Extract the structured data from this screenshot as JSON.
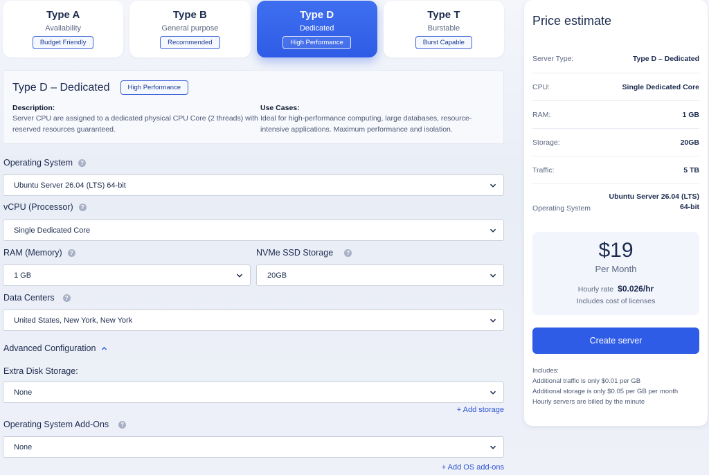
{
  "plans": [
    {
      "title": "Type A",
      "subtitle": "Availability",
      "badge": "Budget Friendly",
      "active": false
    },
    {
      "title": "Type B",
      "subtitle": "General purpose",
      "badge": "Recommended",
      "active": false
    },
    {
      "title": "Type D",
      "subtitle": "Dedicated",
      "badge": "High Performance",
      "active": true
    },
    {
      "title": "Type T",
      "subtitle": "Burstable",
      "badge": "Burst Capable",
      "active": false
    }
  ],
  "detail": {
    "title": "Type D – Dedicated",
    "badge": "High Performance",
    "description_label": "Description:",
    "description": "Server CPU are assigned to a dedicated physical CPU Core (2 threads) with reserved resources guaranteed.",
    "use_cases_label": "Use Cases:",
    "use_cases": "Ideal for high-performance computing, large databases, resource-intensive applications. Maximum performance and isolation."
  },
  "form": {
    "os_label": "Operating System",
    "os_value": "Ubuntu Server 26.04 (LTS) 64-bit",
    "vcpu_label": "vCPU (Processor)",
    "vcpu_value": "Single Dedicated Core",
    "ram_label": "RAM (Memory)",
    "ram_value": "1 GB",
    "storage_label": "NVMe SSD Storage",
    "storage_value": "20GB",
    "dc_label": "Data Centers",
    "dc_value": "United States, New York, New York",
    "advanced_label": "Advanced Configuration",
    "extra_disk_label": "Extra Disk Storage:",
    "extra_disk_value": "None",
    "add_storage": "+ Add storage",
    "os_addons_label": "Operating System Add-Ons",
    "os_addons_value": "None",
    "add_os_addons": "+ Add OS add-ons",
    "help_glyph": "?"
  },
  "estimate": {
    "title": "Price estimate",
    "rows": [
      {
        "key": "Server Type:",
        "value": "Type D – Dedicated"
      },
      {
        "key": "CPU:",
        "value": "Single Dedicated Core"
      },
      {
        "key": "RAM:",
        "value": "1 GB"
      },
      {
        "key": "Storage:",
        "value": "20GB"
      },
      {
        "key": "Traffic:",
        "value": "5 TB"
      }
    ],
    "os_key": "Operating System",
    "os_value_line1": "Ubuntu Server 26.04 (LTS)",
    "os_value_line2": "64-bit",
    "price": "$19",
    "per_month": "Per Month",
    "hourly_label": "Hourly rate",
    "hourly_value": "$0.026/hr",
    "licenses": "Includes cost of licenses",
    "create_button": "Create server",
    "includes_title": "Includes:",
    "includes": [
      "Additional traffic is only $0.01 per GB",
      "Additional storage is only $0.05 per GB per month",
      "Hourly servers are billed by the minute"
    ]
  },
  "colors": {
    "accent": "#2e5ce6",
    "text": "#1c2b4f",
    "muted": "#5b6782"
  },
  "icons": {
    "chevron": "chevron-down-icon",
    "collapse": "chevron-up-icon",
    "help": "help-icon"
  }
}
